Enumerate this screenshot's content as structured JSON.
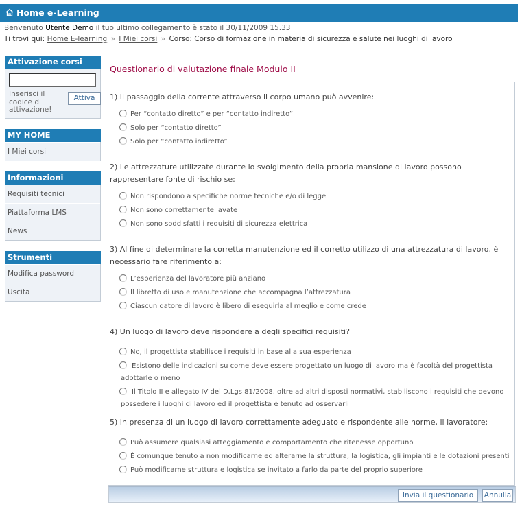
{
  "header": {
    "title": "Home e-Learning",
    "icon": "home-icon"
  },
  "welcome": {
    "prefix": "Benvenuto",
    "user": "Utente Demo",
    "suffix": "il tuo ultimo collegamento è stato il 30/11/2009 15.33"
  },
  "breadcrumb": {
    "label": "Ti trovi qui:",
    "items": [
      "Home E-learning",
      "I Miei corsi"
    ],
    "separator": "»",
    "current": "Corso: Corso di formazione in materia di sicurezza e salute nei luoghi di lavoro"
  },
  "sidebar": {
    "activation": {
      "title": "Attivazione corsi",
      "input_value": "",
      "hint": "Inserisci il codice di attivazione!",
      "button": "Attiva"
    },
    "sections": [
      {
        "title": "MY HOME",
        "items": [
          "I Miei corsi"
        ]
      },
      {
        "title": "Informazioni",
        "items": [
          "Requisiti tecnici",
          "Piattaforma LMS",
          "News"
        ]
      },
      {
        "title": "Strumenti",
        "items": [
          "Modifica password",
          "Uscita"
        ]
      }
    ]
  },
  "main": {
    "title": "Questionario di valutazione finale Modulo II",
    "questions": [
      {
        "text": "1) Il passaggio della corrente attraverso il corpo umano può avvenire:",
        "options": [
          "Per “contatto diretto” e per “contatto indiretto”",
          "Solo per “contatto diretto”",
          "Solo per “contatto indiretto”"
        ]
      },
      {
        "text": "2) Le attrezzature utilizzate durante lo svolgimento della propria mansione di lavoro possono rappresentare fonte di rischio se:",
        "options": [
          "Non rispondono a specifiche norme tecniche e/o di legge",
          "Non sono correttamente lavate",
          "Non sono soddisfatti i requisiti di sicurezza elettrica"
        ]
      },
      {
        "text": "3) Al fine di determinare la corretta manutenzione ed il corretto utilizzo di una attrezzatura di lavoro, è necessario fare riferimento a:",
        "options": [
          "L’esperienza del lavoratore più anziano",
          "Il libretto di uso e manutenzione che accompagna l’attrezzatura",
          "Ciascun datore di lavoro è libero di eseguirla al meglio e come crede"
        ]
      },
      {
        "text": "4) Un luogo di lavoro deve rispondere a degli specifici requisiti?",
        "options": [
          "No, il progettista stabilisce i requisiti in base alla sua esperienza",
          "Esistono delle indicazioni su come deve essere progettato un luogo di lavoro ma è facoltà del progettista adottarle o meno",
          "Il Titolo II e allegato IV del D.Lgs 81/2008, oltre ad altri disposti normativi, stabiliscono i requisiti che devono possedere i luoghi di lavoro ed il progettista è tenuto ad osservarli"
        ]
      },
      {
        "text": "5) In presenza di un luogo di lavoro correttamente adeguato e rispondente alle norme, il lavoratore:",
        "options": [
          "Può assumere qualsiasi atteggiamento e comportamento che ritenesse opportuno",
          "È comunque tenuto a non modificarne ed alterarne la struttura, la logistica, gli impianti e le dotazioni presenti",
          "Può modificarne struttura e logistica se invitato a farlo da parte del proprio superiore"
        ]
      }
    ],
    "submit_button": "Invia il questionario",
    "cancel_button": "Annulla"
  }
}
